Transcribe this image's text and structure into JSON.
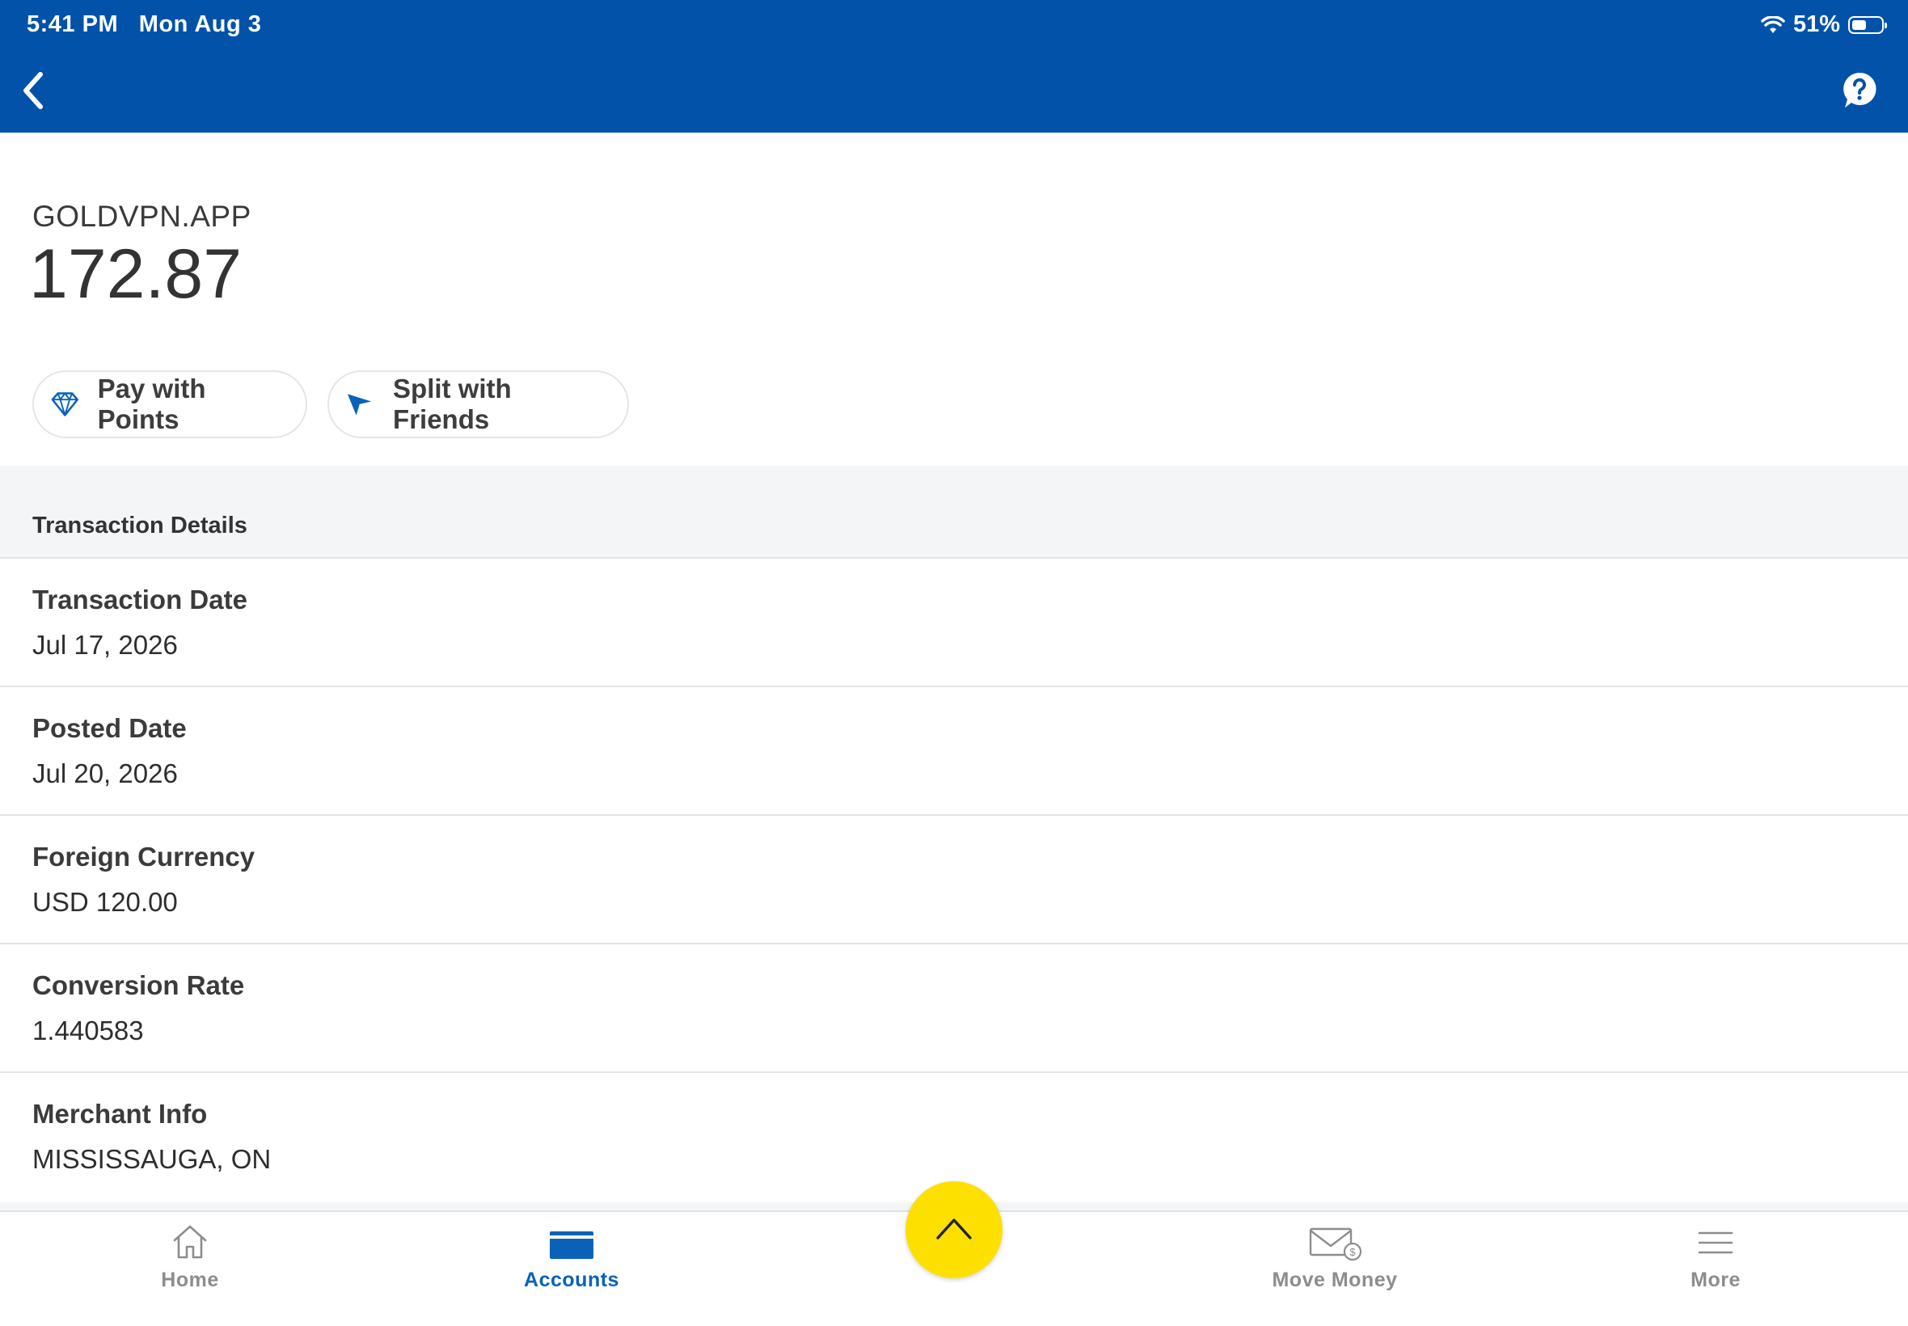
{
  "status_bar": {
    "time": "5:41 PM",
    "date": "Mon Aug 3",
    "battery": "51%",
    "battery_level": 0.51
  },
  "nav": {
    "back_icon": "chevron-left-icon",
    "help_icon": "question-bubble-icon"
  },
  "transaction": {
    "merchant": "GOLDVPN.APP",
    "amount": "172.87"
  },
  "actions": {
    "pay_with_points": "Pay with Points",
    "split_with_friends": "Split with Friends"
  },
  "details": {
    "section_title": "Transaction Details",
    "rows": [
      {
        "label": "Transaction Date",
        "value": "Jul 17, 2026"
      },
      {
        "label": "Posted Date",
        "value": "Jul 20, 2026"
      },
      {
        "label": "Foreign Currency",
        "value": "USD 120.00"
      },
      {
        "label": "Conversion Rate",
        "value": "1.440583"
      },
      {
        "label": "Merchant Info",
        "value": "MISSISSAUGA, ON"
      }
    ]
  },
  "tabs": [
    {
      "label": "Home",
      "icon": "house-icon"
    },
    {
      "label": "Accounts",
      "icon": "card-icon",
      "active": true
    },
    {
      "label": "Move Money",
      "icon": "envelope-dollar-icon"
    },
    {
      "label": "More",
      "icon": "hamburger-icon"
    }
  ],
  "colors": {
    "brand_blue": "#0152a8",
    "accent_yellow": "#fde000",
    "active_tab": "#0a62b8"
  }
}
